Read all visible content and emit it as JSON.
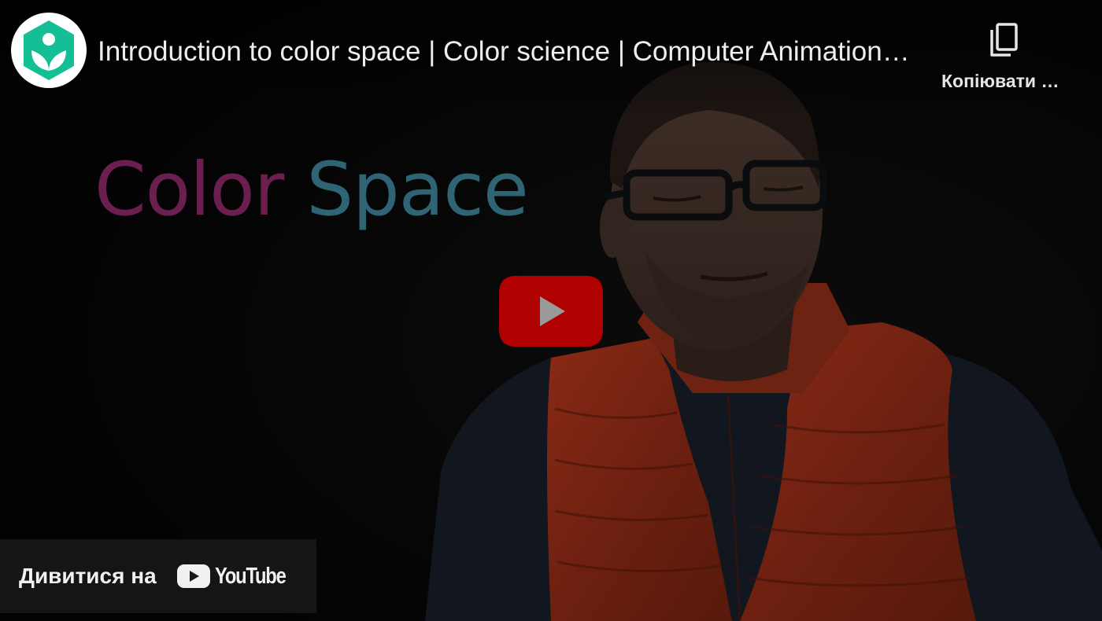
{
  "video": {
    "title": "Introduction to color space | Color science | Computer Animation | Khan Academy",
    "slide_text_word1": "Color",
    "slide_text_word2": "Space"
  },
  "channel": {
    "icon": "khan-academy-logo"
  },
  "actions": {
    "copy_label": "Копіювати посилання",
    "copy_icon": "copy-icon"
  },
  "play": {
    "icon": "play-icon"
  },
  "watch_on": {
    "label": "Дивитися на",
    "logo_text": "YouTube"
  },
  "colors": {
    "play_button": "#b00000",
    "khan_green": "#14bf96",
    "slide_word1": "#6b1f4f",
    "slide_word2": "#2e6474",
    "vest": "#7a2412"
  }
}
